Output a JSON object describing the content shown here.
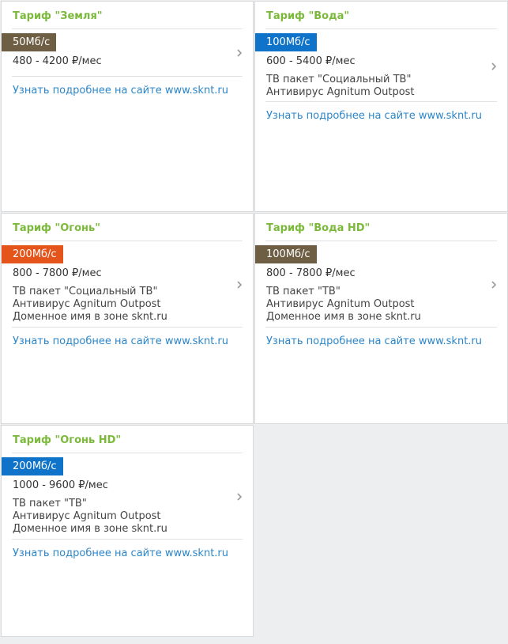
{
  "colors": {
    "title_green": "#7bb93a",
    "badge_brown": "#6e5e44",
    "badge_blue": "#0f74c9",
    "badge_orange": "#e5541b",
    "link_blue": "#2c86c8"
  },
  "tariffs": [
    {
      "title": "Тариф \"Земля\"",
      "speed": "50Мб/с",
      "badge_color": "#6e5e44",
      "price": "480 - 4200 ₽/мес",
      "features": [],
      "link": "Узнать подробнее на сайте www.sknt.ru"
    },
    {
      "title": "Тариф \"Вода\"",
      "speed": "100Мб/с",
      "badge_color": "#0f74c9",
      "price": "600 - 5400 ₽/мес",
      "features": [
        "ТВ пакет \"Социальный ТВ\"",
        "Антивирус Agnitum Outpost"
      ],
      "link": "Узнать подробнее на сайте www.sknt.ru"
    },
    {
      "title": "Тариф \"Огонь\"",
      "speed": "200Мб/с",
      "badge_color": "#e5541b",
      "price": "800 - 7800 ₽/мес",
      "features": [
        "ТВ пакет \"Социальный ТВ\"",
        "Антивирус Agnitum Outpost",
        "Доменное имя в зоне sknt.ru"
      ],
      "link": "Узнать подробнее на сайте www.sknt.ru"
    },
    {
      "title": "Тариф \"Вода HD\"",
      "speed": "100Мб/с",
      "badge_color": "#6e5e44",
      "price": "800 - 7800 ₽/мес",
      "features": [
        "ТВ пакет \"ТВ\"",
        "Антивирус Agnitum Outpost",
        "Доменное имя в зоне sknt.ru"
      ],
      "link": "Узнать подробнее на сайте www.sknt.ru"
    },
    {
      "title": "Тариф \"Огонь HD\"",
      "speed": "200Мб/с",
      "badge_color": "#0f74c9",
      "price": "1000 - 9600 ₽/мес",
      "features": [
        "ТВ пакет \"ТВ\"",
        "Антивирус Agnitum Outpost",
        "Доменное имя в зоне sknt.ru"
      ],
      "link": "Узнать подробнее на сайте www.sknt.ru"
    }
  ]
}
